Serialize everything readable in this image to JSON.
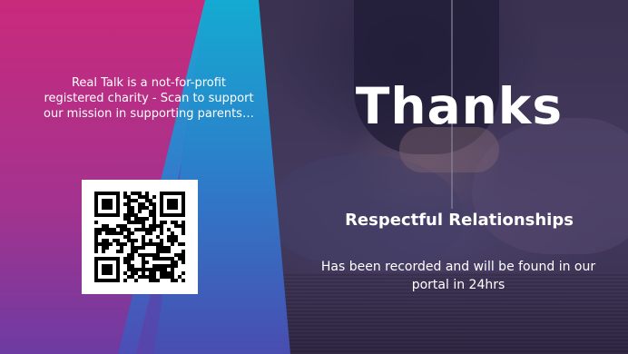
{
  "slide": {
    "blurb": "Real Talk is a not-for-profit registered charity - Scan to support our mission in supporting parents…",
    "title": "Thanks",
    "subtitle": "Respectful Relationships",
    "body": "Has been recorded and will be found in our portal in 24hrs"
  },
  "colors": {
    "magenta": "#c8237e",
    "purple": "#7b3fa3",
    "cyan": "#13a9d6",
    "blue": "#3b5bc0",
    "text": "#ffffff"
  }
}
